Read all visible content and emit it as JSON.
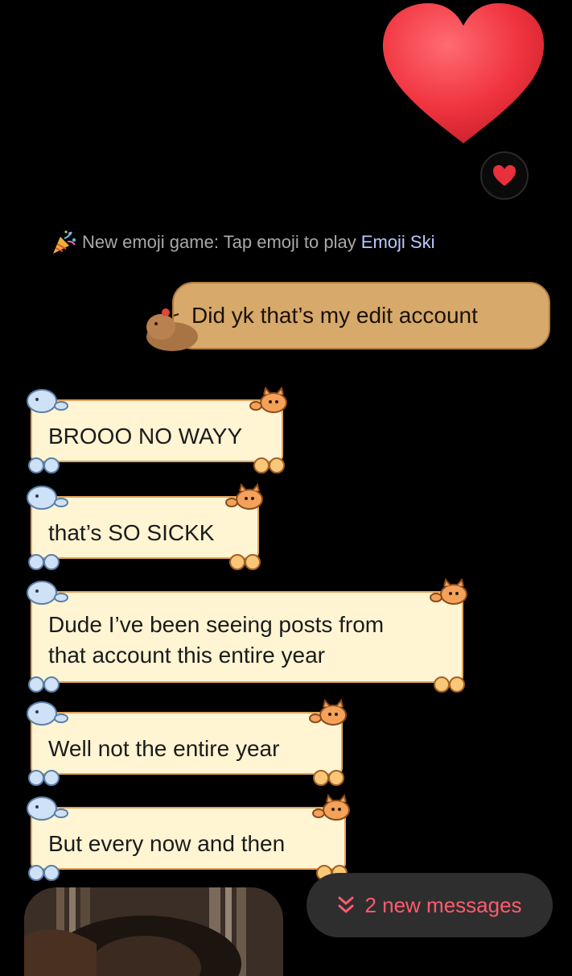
{
  "reaction": {
    "big_emoji_icon": "heart-icon",
    "chip_icon": "heart-icon"
  },
  "system_note": {
    "text": "New emoji game: Tap emoji to play",
    "link": "Emoji Ski",
    "icon": "party-popper-icon"
  },
  "sent_messages": [
    {
      "text": "Did yk that’s my edit account"
    }
  ],
  "received_messages": [
    {
      "text": "BROOO NO WAYY"
    },
    {
      "text": "that’s SO SICKK"
    },
    {
      "line1": "Dude I’ve been seeing posts from",
      "line2": "that account this entire year"
    },
    {
      "text": "Well not the entire year"
    },
    {
      "text": "But every now and then"
    }
  ],
  "new_messages_button": {
    "label": "2 new messages",
    "icon": "double-chevron-down-icon"
  },
  "colors": {
    "background": "#000000",
    "sent_bubble": "#d7a96a",
    "received_bubble": "#fff5d3",
    "accent_red": "#ff5b6e",
    "link": "#b9c8ff"
  }
}
